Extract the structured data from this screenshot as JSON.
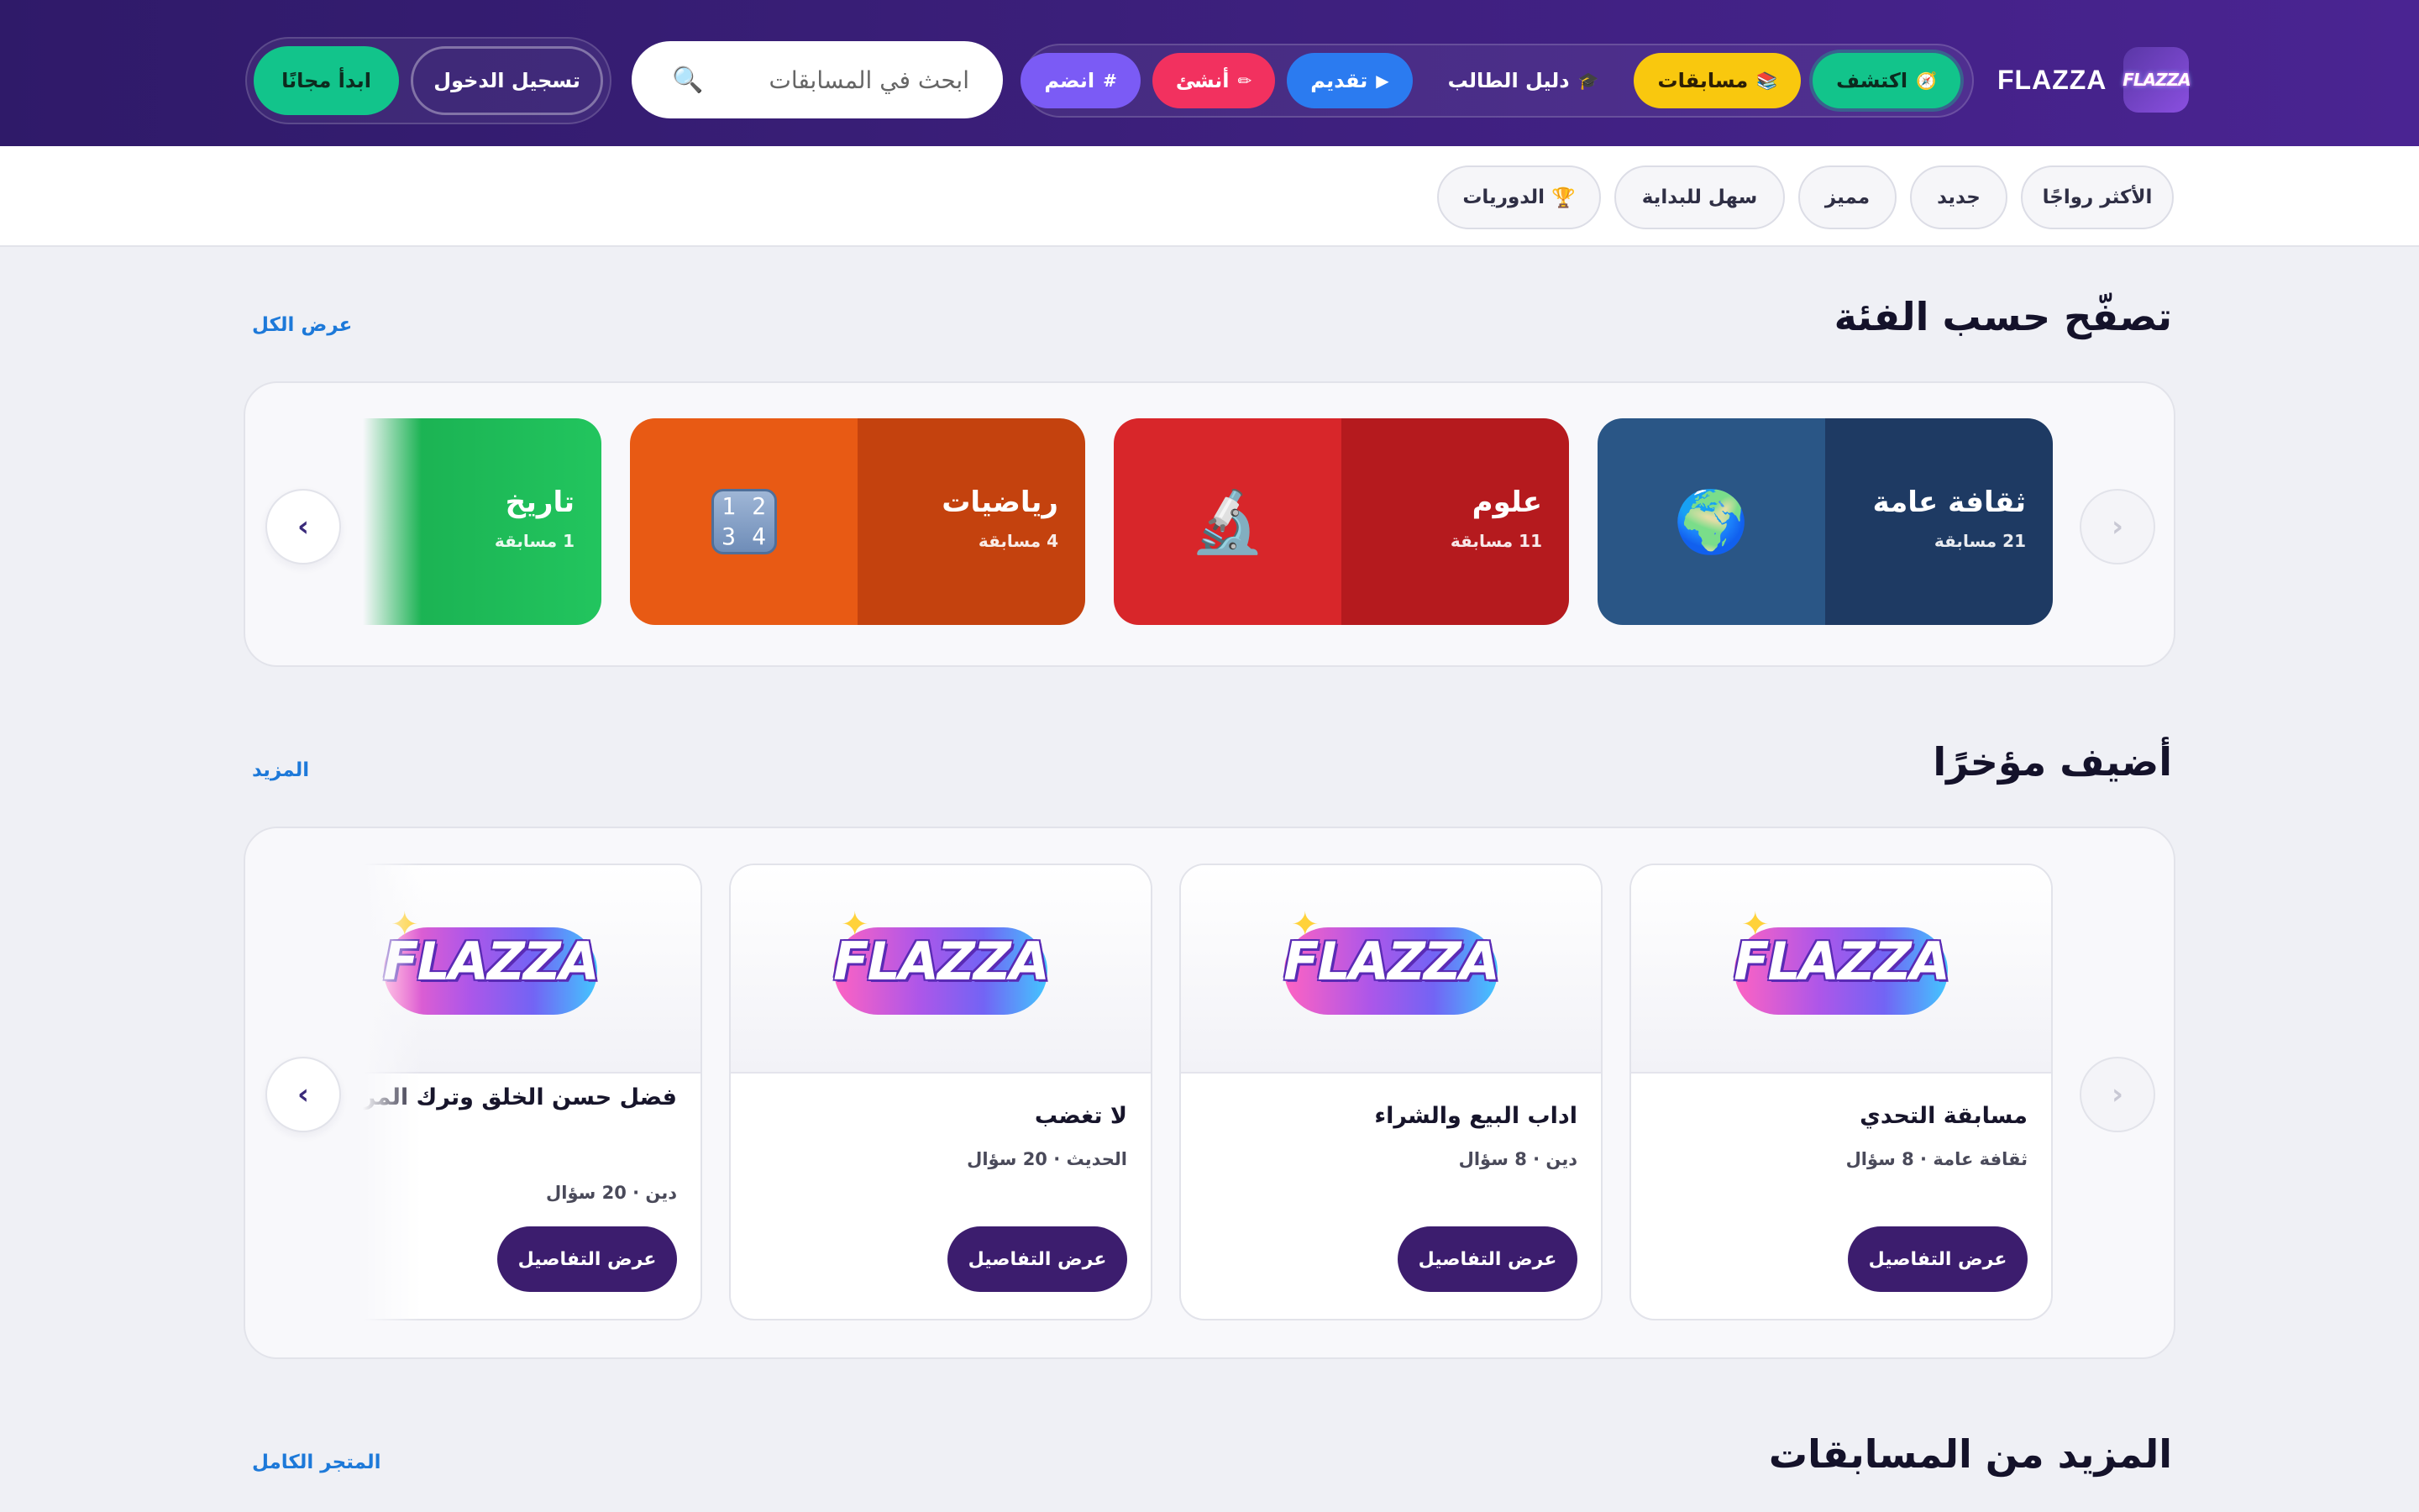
{
  "brand": {
    "name": "FLAZZA",
    "logo_text": "FLAZZA"
  },
  "nav": {
    "explore": {
      "label": "اكتشف",
      "icon": "🧭"
    },
    "quizzes": {
      "label": "مسابقات",
      "icon": "📚"
    },
    "guide": {
      "label": "دليل الطالب",
      "icon": "🎓"
    },
    "submit": {
      "label": "تقديم",
      "icon": "▶"
    },
    "create": {
      "label": "أنشئ",
      "icon": "✏"
    },
    "join": {
      "label": "انضم",
      "icon": "#"
    }
  },
  "search": {
    "placeholder": "ابحث في المسابقات",
    "icon": "🔍"
  },
  "auth": {
    "login_label": "تسجيل الدخول",
    "start_label": "ابدأ مجانًا"
  },
  "filters": [
    {
      "label": "الأكثر رواجًا",
      "icon": ""
    },
    {
      "label": "جديد",
      "icon": ""
    },
    {
      "label": "مميز",
      "icon": ""
    },
    {
      "label": "سهل للبداية",
      "icon": ""
    },
    {
      "label": "الدوريات",
      "icon": "🏆"
    }
  ],
  "categories_section": {
    "title": "تصفّح حسب الفئة",
    "link": "عرض الكل",
    "items": [
      {
        "name": "ثقافة عامة",
        "count": "21 مسابقة",
        "icon": "🌍",
        "color_a": "#1e3a63",
        "color_b": "#2a5686"
      },
      {
        "name": "علوم",
        "count": "11 مسابقة",
        "icon": "🔬",
        "color_a": "#b51a1e",
        "color_b": "#d8262a"
      },
      {
        "name": "رياضيات",
        "count": "4 مسابقة",
        "icon": "1234",
        "color_a": "#c4420e",
        "color_b": "#e85a14"
      },
      {
        "name": "تاريخ",
        "count": "1 مسابقة",
        "icon": "",
        "color_a": "#15a34a",
        "color_b": "#22c55e"
      }
    ]
  },
  "recent_section": {
    "title": "أضيف مؤخرًا",
    "link": "المزيد",
    "items": [
      {
        "title": "مسابقة التحدي",
        "meta": "ثقافة عامة · 8 سؤال",
        "button": "عرض التفاصيل"
      },
      {
        "title": "اداب البيع والشراء",
        "meta": "دين · 8 سؤال",
        "button": "عرض التفاصيل"
      },
      {
        "title": "لا تغضب",
        "meta": "الحديث · 20 سؤال",
        "button": "عرض التفاصيل"
      },
      {
        "title": "فضل حسن الخلق وترك المراء",
        "meta": "دين · 20 سؤال",
        "button": "عرض التفاصيل"
      }
    ]
  },
  "more_section": {
    "title": "المزيد من المسابقات",
    "link": "المتجر الكامل"
  },
  "carousel": {
    "prev_icon": "›",
    "next_icon": "‹"
  },
  "colors": {
    "header_dark": "#2f1a69",
    "accent_green": "#12c48b",
    "accent_yellow": "#f9c80e",
    "button_dark": "#3c1d6e",
    "link_blue": "#1d79d9"
  }
}
